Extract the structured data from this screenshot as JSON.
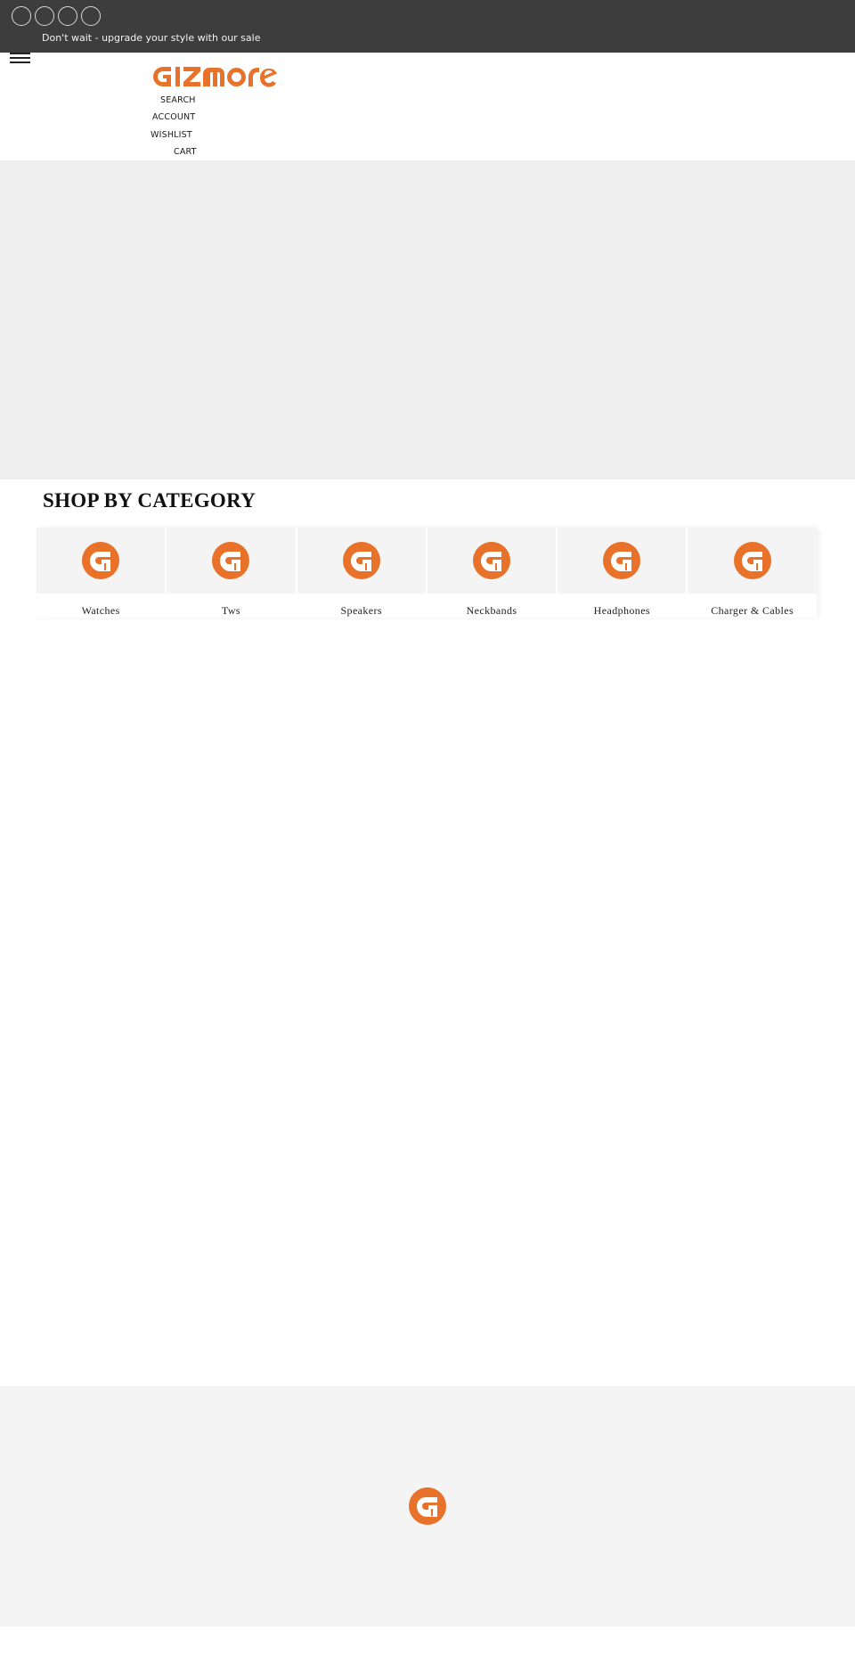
{
  "announcement": {
    "social_icons": [
      "social-circle-icon",
      "social-circle-icon",
      "social-circle-icon",
      "social-circle-icon"
    ],
    "text": "Don't wait - upgrade your style with our sale"
  },
  "header": {
    "menu_icon": "hamburger-menu-icon",
    "logo_text": "GIZMOre",
    "nav": {
      "search": "SEARCH",
      "account": "ACCOUNT",
      "wishlist": "WISHLIST",
      "cart": "CART"
    }
  },
  "colors": {
    "brand_orange": "#e8722a",
    "announcement_bg": "#3d3d3d",
    "hero_bg": "#eeeeee",
    "card_bg": "#f4f4f4"
  },
  "categories": {
    "title": "SHOP BY CATEGORY",
    "items": [
      {
        "label": "Watches",
        "icon": "gizmore-g-logo-icon"
      },
      {
        "label": "Tws",
        "icon": "gizmore-g-logo-icon"
      },
      {
        "label": "Speakers",
        "icon": "gizmore-g-logo-icon"
      },
      {
        "label": "Neckbands",
        "icon": "gizmore-g-logo-icon"
      },
      {
        "label": "Headphones",
        "icon": "gizmore-g-logo-icon"
      },
      {
        "label": "Charger & Cables",
        "icon": "gizmore-g-logo-icon"
      }
    ]
  }
}
